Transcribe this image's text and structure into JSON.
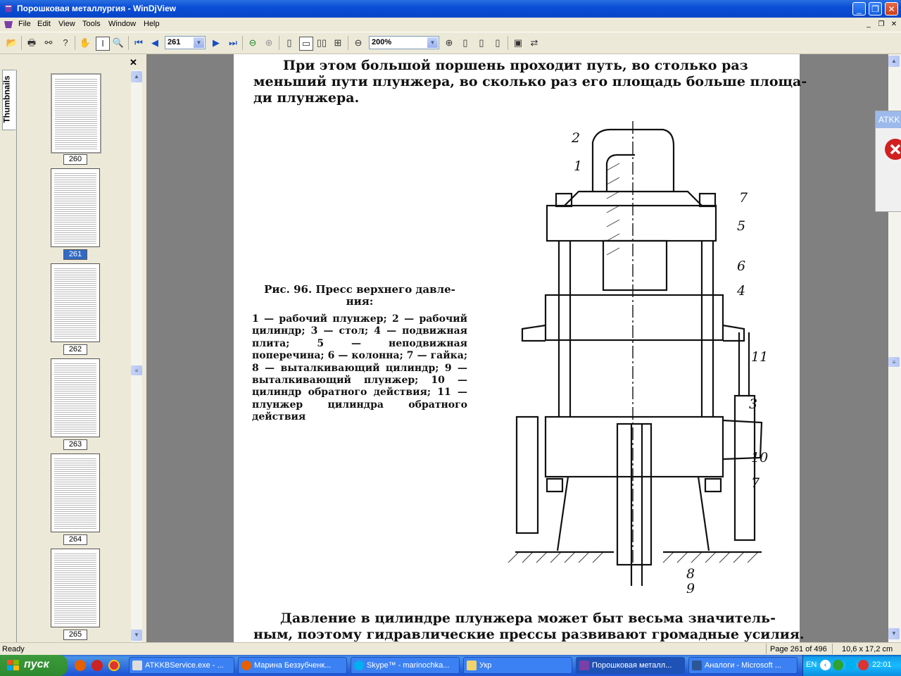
{
  "window": {
    "title": "Порошковая металлургия - WinDjView"
  },
  "menu": [
    "File",
    "Edit",
    "View",
    "Tools",
    "Window",
    "Help"
  ],
  "toolbar": {
    "page_number": "261",
    "zoom": "200%"
  },
  "sidebar": {
    "tab_label": "Thumbnails",
    "thumbnails": [
      {
        "label": "260",
        "selected": false
      },
      {
        "label": "261",
        "selected": true
      },
      {
        "label": "262",
        "selected": false
      },
      {
        "label": "263",
        "selected": false
      },
      {
        "label": "264",
        "selected": false
      },
      {
        "label": "265",
        "selected": false
      }
    ]
  },
  "page": {
    "line1": "При  этом  большой  поршень  проходит  путь,  во  столько  раз",
    "line2": "меньший пути плунжера, во сколько раз его площадь больше площа-",
    "line3": "ди плунжера.",
    "caption_title": "Рис.  96.  Пресс  верхнего  давле-ния:",
    "caption_body": "1 — рабочий плунжер; 2 — рабочий цилиндр; 3 — стол; 4 — подвижная плита; 5 — неподвижная поперечина; 6 — колонна; 7 — гайка; 8 — выталкивающий цилиндр; 9 — выталкивающий плунжер; 10 — цилиндр обратного действия; 11 — плунжер цилиндра обратного действия",
    "bottom1": "Давление  в  цилиндре  плунжера  может  быт  весьма   значитель-",
    "bottom2": "ным,  поэтому  гидравлические  прессы  развивают  громадные  усилия.",
    "labels": [
      "2",
      "1",
      "7",
      "5",
      "6",
      "4",
      "11",
      "3",
      "10",
      "7",
      "8",
      "9"
    ]
  },
  "popup": {
    "title": "ATKK"
  },
  "status": {
    "left": "Ready",
    "page": "Page 261 of 496",
    "size": "10,6 x 17,2 cm"
  },
  "taskbar": {
    "start": "пуск",
    "items": [
      {
        "label": "ATKKBService.exe - ..."
      },
      {
        "label": "Марина Беззубченк..."
      },
      {
        "label": "Skype™ - marinochka..."
      },
      {
        "label": "Укр"
      },
      {
        "label": "Порошковая металл..."
      },
      {
        "label": "Аналоги - Microsoft ..."
      }
    ],
    "lang": "EN",
    "clock": "22:01"
  }
}
